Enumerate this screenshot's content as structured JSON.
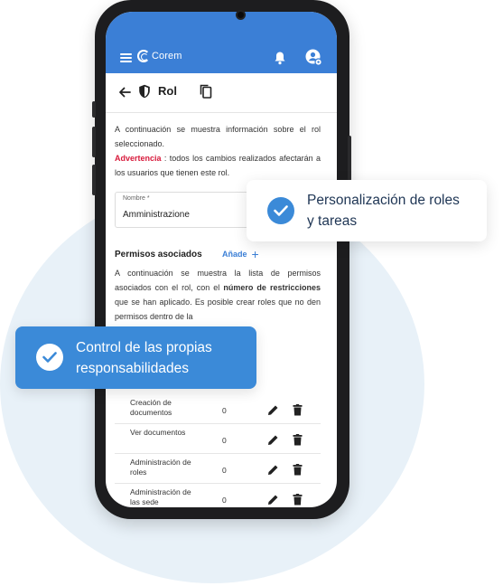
{
  "app": {
    "name": "Corem"
  },
  "toolbar": {
    "title": "Rol"
  },
  "info": {
    "intro": "A continuación se muestra información sobre el rol seleccionado.",
    "warning_label": "Advertencia",
    "warning_text": ": todos los cambios realizados afectarán a los usuarios que tienen este rol."
  },
  "form": {
    "name_label": "Nombre *",
    "name_value": "Amministrazione"
  },
  "permissions": {
    "title": "Permisos asociados",
    "add_label": "Añade",
    "desc_part1": "A continuación se muestra la lista de permisos asociados con el rol, con el",
    "desc_bold": "número de restricciones",
    "desc_part2": "que se han aplicado. Es posible crear roles que no den permisos dentro de la",
    "rows": [
      {
        "name": "Creación de documentos",
        "count": "0"
      },
      {
        "name": "Ver documentos",
        "count": "0"
      },
      {
        "name": "Administración de roles",
        "count": "0"
      },
      {
        "name": "Administración de las sede",
        "count": "0"
      }
    ]
  },
  "callouts": {
    "right": "Personalización de roles y tareas",
    "left": "Control de las propias responsabilidades"
  },
  "colors": {
    "brand": "#3b7fd6",
    "warning": "#d81b3c",
    "callout_text": "#1e3554",
    "circle": "#e8f1f8"
  },
  "icons": [
    "menu-icon",
    "logo-icon",
    "bell-icon",
    "account-settings-icon",
    "back-arrow-icon",
    "shield-icon",
    "copy-icon",
    "plus-icon",
    "edit-icon",
    "delete-icon",
    "check-icon"
  ]
}
